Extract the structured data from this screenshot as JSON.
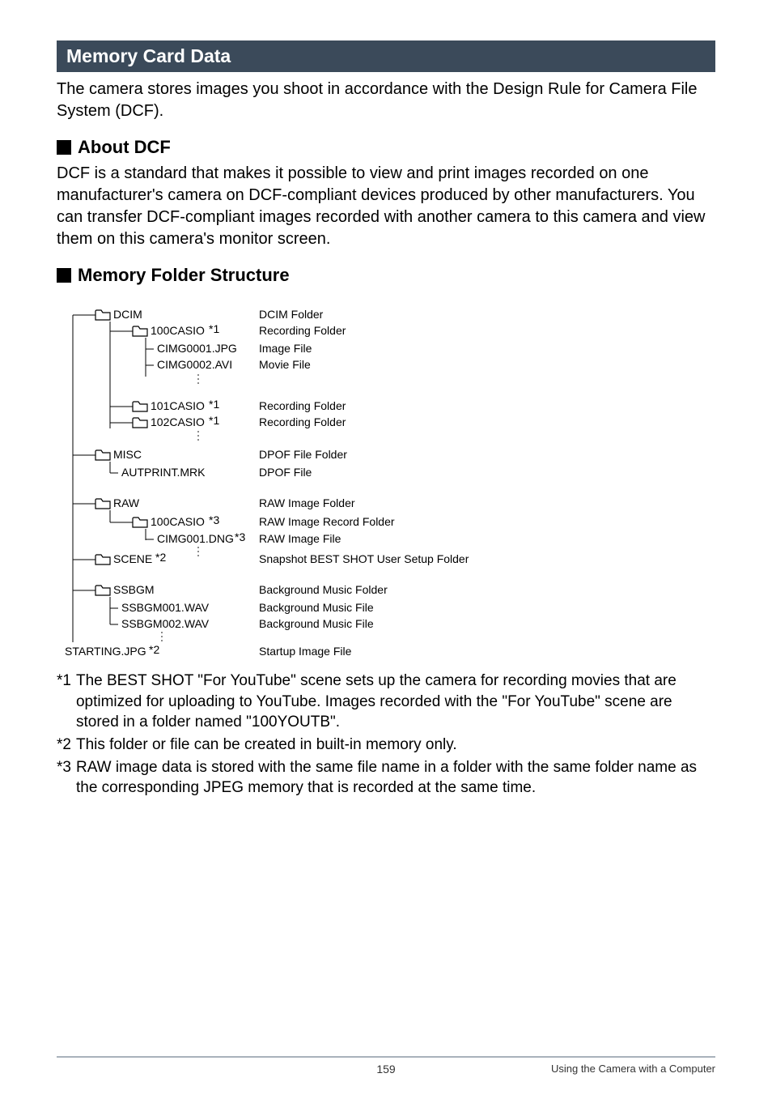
{
  "section_title": "Memory Card Data",
  "intro": "The camera stores images you shoot in accordance with the Design Rule for Camera File System (DCF).",
  "about_dcf": {
    "heading": "About DCF",
    "text": "DCF is a standard that makes it possible to view and print images recorded on one manufacturer's camera on DCF-compliant devices produced by other manufacturers. You can transfer DCF-compliant images recorded with another camera to this camera and view them on this camera's monitor screen."
  },
  "folder_structure_heading": "Memory Folder Structure",
  "tree": {
    "dcim": "DCIM",
    "dcim_meaning": "DCIM Folder",
    "rec100": "100CASIO",
    "rec101": "101CASIO",
    "rec102": "102CASIO",
    "rec_meaning": "Recording Folder",
    "img_jpg": "CIMG0001.JPG",
    "img_jpg_meaning": "Image File",
    "img_avi": "CIMG0002.AVI",
    "img_avi_meaning": "Movie File",
    "misc": "MISC",
    "misc_meaning": "DPOF File Folder",
    "autprint": "AUTPRINT.MRK",
    "autprint_meaning": "DPOF File",
    "raw": "RAW",
    "raw_meaning": "RAW Image Folder",
    "raw100": "100CASIO",
    "raw100_meaning": "RAW Image Record Folder",
    "raw_dng": "CIMG001.DNG",
    "raw_dng_meaning": "RAW Image File",
    "scene": "SCENE",
    "scene_meaning": "Snapshot BEST SHOT User Setup Folder",
    "ssbgm": "SSBGM",
    "ssbgm_meaning": "Background Music Folder",
    "ssbgm001": "SSBGM001.WAV",
    "ssbgm002": "SSBGM002.WAV",
    "ssbgm_file_meaning": "Background Music File",
    "starting": "STARTING.JPG",
    "starting_meaning": "Startup Image File",
    "ast1": "*1",
    "ast2": "*2",
    "ast3": "*3"
  },
  "footnotes": {
    "fn1_mark": "*1",
    "fn1": "The BEST SHOT \"For YouTube\" scene sets up the camera for recording movies that are optimized for uploading to YouTube. Images recorded with the \"For YouTube\" scene are stored in a folder named \"100YOUTB\".",
    "fn2_mark": "*2",
    "fn2": "This folder or file can be created in built-in memory only.",
    "fn3_mark": "*3",
    "fn3": "RAW image data is stored with the same file name in a folder with the same folder name as the corresponding JPEG memory that is recorded at the same time."
  },
  "footer": {
    "page": "159",
    "section": "Using the Camera with a Computer"
  }
}
